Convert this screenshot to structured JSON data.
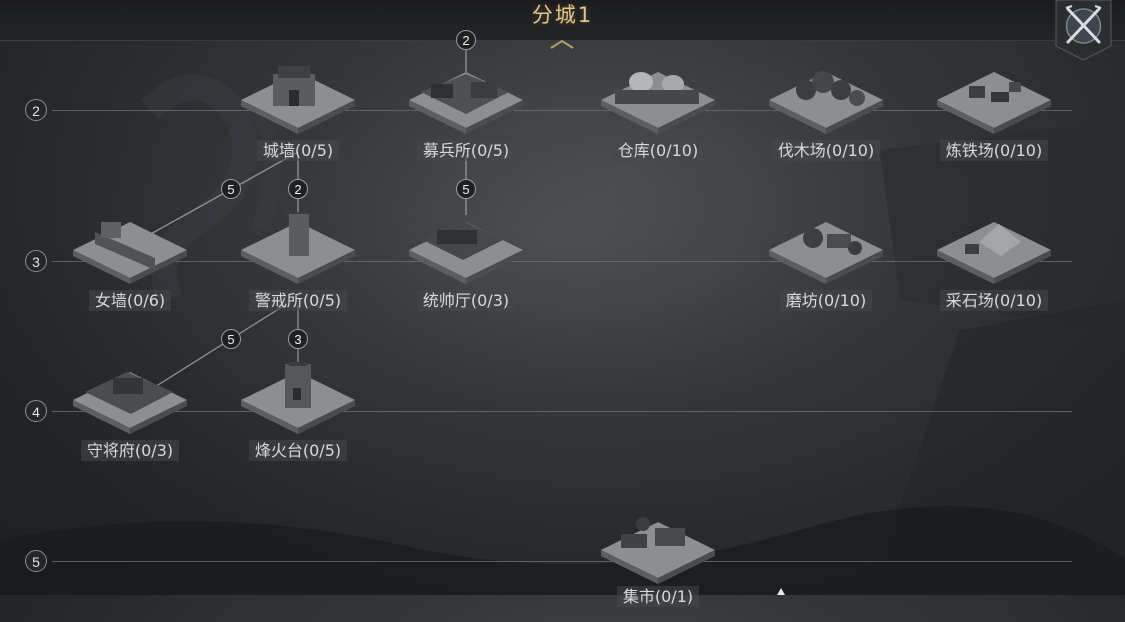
{
  "title": "分城1",
  "close_icon": "crossed-swords-icon",
  "tiers": [
    "2",
    "3",
    "4",
    "5"
  ],
  "buildings": {
    "chengqiang": "城墙(0/5)",
    "mubingsuo": "募兵所(0/5)",
    "cangku": "仓库(0/10)",
    "famuchang": "伐木场(0/10)",
    "liantiechang": "炼铁场(0/10)",
    "nvqiang": "女墙(0/6)",
    "jingjiesuo": "警戒所(0/5)",
    "tongshuaiting": "统帅厅(0/3)",
    "mofang": "磨坊(0/10)",
    "caishichang": "采石场(0/10)",
    "shoujiangfu": "守将府(0/3)",
    "fenghuotai": "烽火台(0/5)",
    "jishi": "集市(0/1)"
  },
  "requirements": {
    "mubingsuo_top": "2",
    "nvqiang_from_chengqiang": "5",
    "jingjiesuo_from_chengqiang": "2",
    "tongshuaiting_from_mubingsuo": "5",
    "shoujiangfu_from_jingjiesuo": "5",
    "fenghuotai_from_jingjiesuo": "3"
  },
  "colors": {
    "title": "#e4c48a",
    "label": "#d9d9d9",
    "line": "#6e7276"
  }
}
